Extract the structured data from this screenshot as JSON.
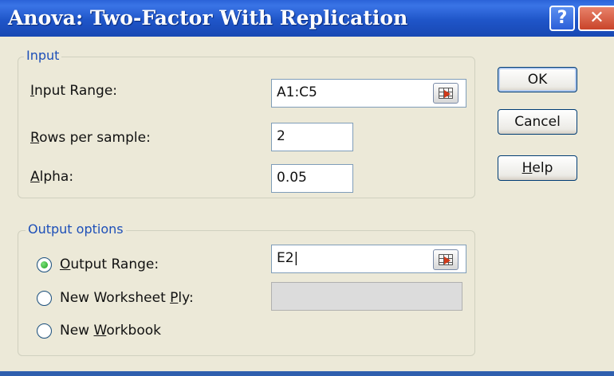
{
  "dialog": {
    "title": "Anova: Two-Factor With Replication",
    "help_glyph": "?",
    "close_glyph": "✕"
  },
  "input_group": {
    "legend": "Input",
    "input_range_label_first": "I",
    "input_range_label_rest": "nput Range:",
    "input_range_value": "A1:C5",
    "rows_label_first": "R",
    "rows_label_rest": "ows per sample:",
    "rows_value": "2",
    "alpha_label_first": "A",
    "alpha_label_rest": "lpha:",
    "alpha_value": "0.05"
  },
  "output_group": {
    "legend": "Output options",
    "options": [
      {
        "label_first": "O",
        "label_rest": "utput Range:",
        "selected": true
      },
      {
        "label_pre": "New Worksheet ",
        "label_accel": "P",
        "label_post": "ly:",
        "selected": false
      },
      {
        "label_pre": "New ",
        "label_accel": "W",
        "label_post": "orkbook",
        "selected": false
      }
    ],
    "output_range_value": "E2|",
    "worksheet_ply_value": ""
  },
  "buttons": {
    "ok": "OK",
    "cancel": "Cancel",
    "help_first": "H",
    "help_rest": "elp"
  },
  "icons": [
    "help-icon",
    "close-icon",
    "range-selector-icon"
  ]
}
